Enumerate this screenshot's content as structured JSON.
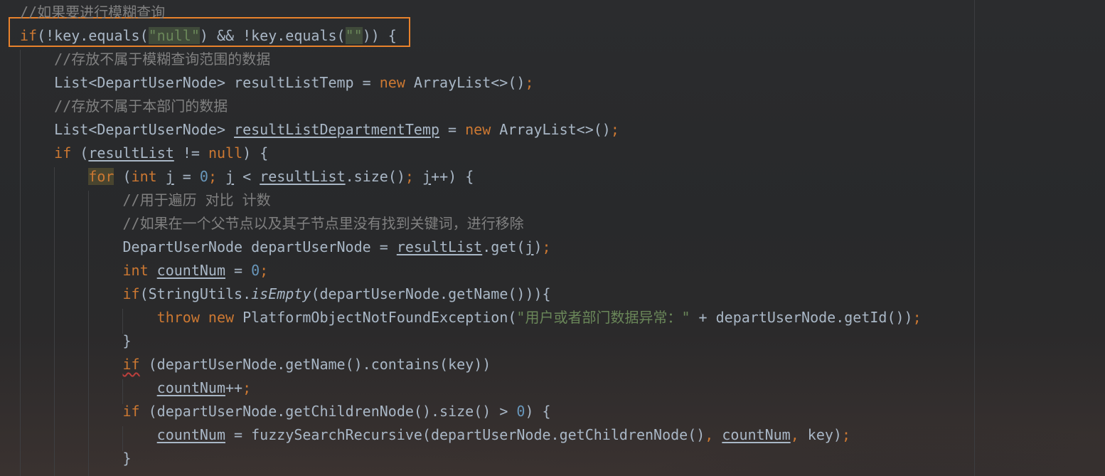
{
  "code_lines": [
    "//如果要进行模糊查询",
    "if(!key.equals(\"null\") && !key.equals(\"\")) {",
    "    //存放不属于模糊查询范围的数据",
    "    List<DepartUserNode> resultListTemp = new ArrayList<>();",
    "    //存放不属于本部门的数据",
    "    List<DepartUserNode> resultListDepartmentTemp = new ArrayList<>();",
    "    if (resultList != null) {",
    "        for (int j = 0; j < resultList.size(); j++) {",
    "            //用于遍历 对比 计数",
    "            //如果在一个父节点以及其子节点里没有找到关键词，进行移除",
    "            DepartUserNode departUserNode = resultList.get(j);",
    "            int countNum = 0;",
    "            if(StringUtils.isEmpty(departUserNode.getName())){",
    "                throw new PlatformObjectNotFoundException(\"用户或者部门数据异常：\" + departUserNode.getId());",
    "            }",
    "            if (departUserNode.getName().contains(key))",
    "                countNum++;",
    "            if (departUserNode.getChildrenNode().size() > 0) {",
    "                countNum = fuzzySearchRecursive(departUserNode.getChildrenNode(), countNum, key);",
    "            }"
  ],
  "syntax_colors": {
    "keyword": "#cc7832",
    "string": "#6a8759",
    "number": "#6897bb",
    "comment": "#808080",
    "text": "#a9b7c6",
    "highlight_box": "#e8822c"
  }
}
